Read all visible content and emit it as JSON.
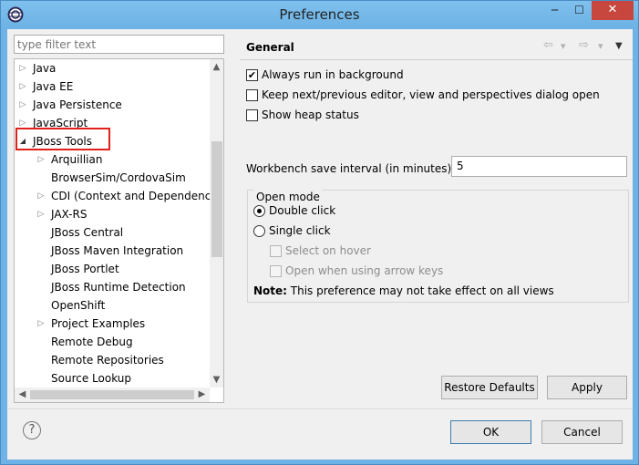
{
  "window": {
    "title": "Preferences",
    "min_glyph": "─",
    "max_glyph": "☐",
    "close_glyph": "✕"
  },
  "filter": {
    "placeholder": "type filter text"
  },
  "tree": {
    "items": [
      {
        "label": "Java",
        "level": 0,
        "expander": "collapsed"
      },
      {
        "label": "Java EE",
        "level": 0,
        "expander": "collapsed"
      },
      {
        "label": "Java Persistence",
        "level": 0,
        "expander": "collapsed"
      },
      {
        "label": "JavaScript",
        "level": 0,
        "expander": "collapsed"
      },
      {
        "label": "JBoss Tools",
        "level": 0,
        "expander": "expanded",
        "highlighted": true
      },
      {
        "label": "Arquillian",
        "level": 1,
        "expander": "collapsed"
      },
      {
        "label": "BrowserSim/CordovaSim",
        "level": 1,
        "expander": "none"
      },
      {
        "label": "CDI (Context and Dependency",
        "level": 1,
        "expander": "collapsed"
      },
      {
        "label": "JAX-RS",
        "level": 1,
        "expander": "collapsed"
      },
      {
        "label": "JBoss Central",
        "level": 1,
        "expander": "none"
      },
      {
        "label": "JBoss Maven Integration",
        "level": 1,
        "expander": "none"
      },
      {
        "label": "JBoss Portlet",
        "level": 1,
        "expander": "none"
      },
      {
        "label": "JBoss Runtime Detection",
        "level": 1,
        "expander": "none"
      },
      {
        "label": "OpenShift",
        "level": 1,
        "expander": "none"
      },
      {
        "label": "Project Examples",
        "level": 1,
        "expander": "collapsed"
      },
      {
        "label": "Remote Debug",
        "level": 1,
        "expander": "none"
      },
      {
        "label": "Remote Repositories",
        "level": 1,
        "expander": "none"
      },
      {
        "label": "Source Lookup",
        "level": 1,
        "expander": "none"
      }
    ],
    "highlight_color": "#e0201c"
  },
  "page": {
    "title": "General",
    "nav": {
      "back": "⇦",
      "back_menu": "▾",
      "forward": "⇨",
      "forward_menu": "▾",
      "view_menu": "▼"
    },
    "options": [
      {
        "label": "Always run in background",
        "checked": true,
        "enabled": true
      },
      {
        "label": "Keep next/previous editor, view and perspectives dialog open",
        "checked": false,
        "enabled": true
      },
      {
        "label": "Show heap status",
        "checked": false,
        "enabled": true
      }
    ],
    "interval_label": "Workbench save interval (in minutes):",
    "interval_value": "5",
    "open_mode": {
      "legend": "Open mode",
      "double_click": "Double click",
      "single_click": "Single click",
      "selected": "Double click",
      "select_on_hover": "Select on hover",
      "open_arrow_keys": "Open when using arrow keys"
    },
    "note_bold": "Note:",
    "note_text": " This preference may not take effect on all views",
    "restore_defaults": "Restore Defaults",
    "apply": "Apply"
  },
  "footer": {
    "help": "?",
    "ok": "OK",
    "cancel": "Cancel"
  },
  "colors": {
    "titlebar": "#6cb2e4",
    "close": "#c7463e",
    "dialog_bg": "#f0f0f0"
  }
}
